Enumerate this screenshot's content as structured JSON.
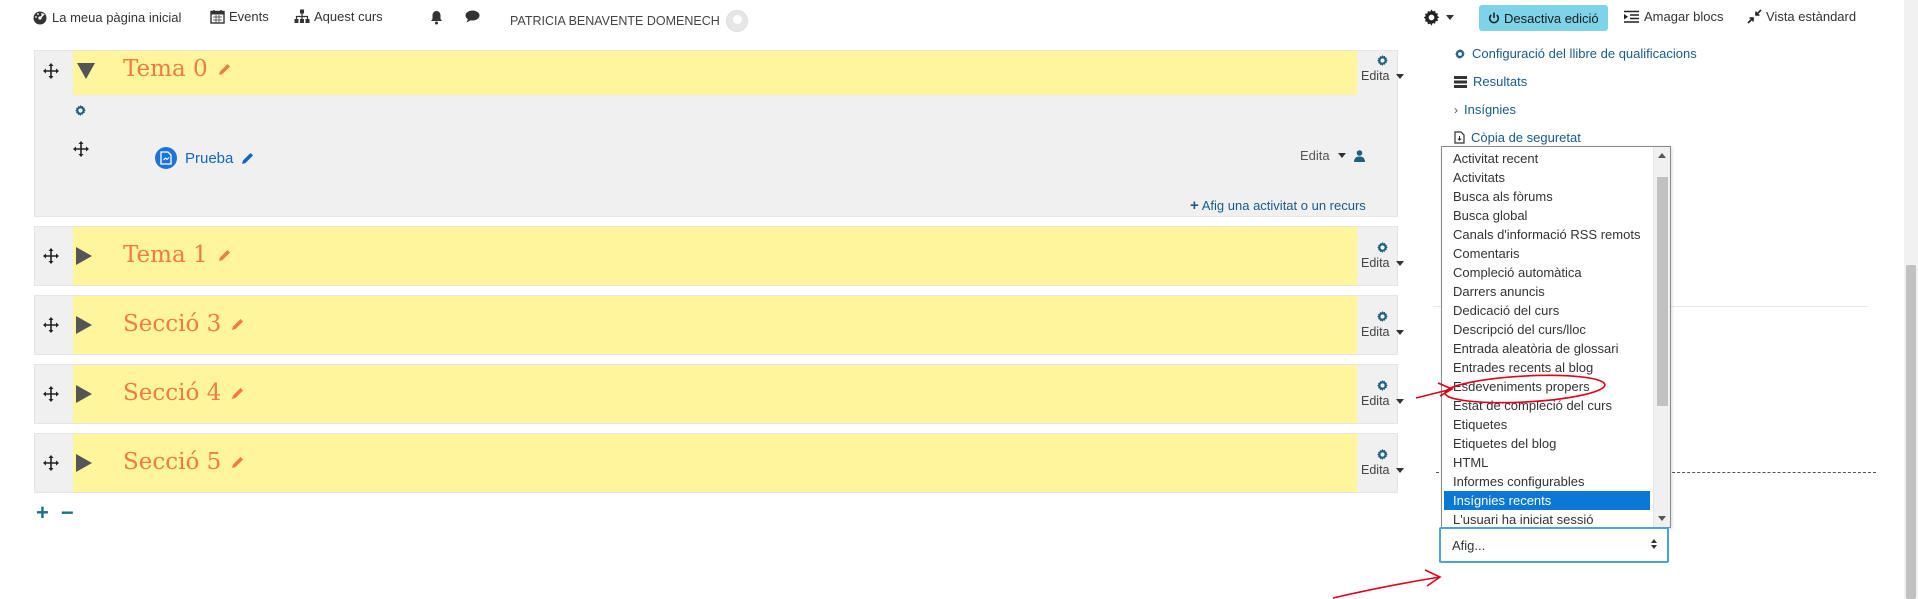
{
  "nav": {
    "home": "La meua pàgina inicial",
    "events": "Events",
    "course": "Aquest curs",
    "user": "PATRICIA BENAVENTE DOMENECH",
    "edit_off": "Desactiva edició",
    "hide_blocks": "Amagar blocs",
    "standard_view": "Vista estàndard"
  },
  "sections": [
    {
      "title": "Tema 0",
      "edit": "Edita"
    },
    {
      "title": "Tema 1",
      "edit": "Edita"
    },
    {
      "title": "Secció 3",
      "edit": "Edita"
    },
    {
      "title": "Secció 4",
      "edit": "Edita"
    },
    {
      "title": "Secció 5",
      "edit": "Edita"
    }
  ],
  "activity": {
    "name": "Prueba",
    "edit": "Edita",
    "add": "Afig una activitat o un recurs"
  },
  "admin_links": {
    "gradebook_setup": "Configuració del llibre de qualificacions",
    "outcomes": "Resultats",
    "badges": "Insígnies",
    "backup": "Còpia de seguretat"
  },
  "block_list": {
    "items": [
      "Activitat recent",
      "Activitats",
      "Busca als fòrums",
      "Busca global",
      "Canals d'informació RSS remots",
      "Comentaris",
      "Compleció automàtica",
      "Darrers anuncis",
      "Dedicació del curs",
      "Descripció del curs/lloc",
      "Entrada aleatòria de glossari",
      "Entrades recents al blog",
      "Esdeveniments propers",
      "Estat de compleció del curs",
      "Etiquetes",
      "Etiquetes del blog",
      "HTML",
      "Informes configurables",
      "Insígnies recents",
      "L'usuari ha iniciat sessió"
    ],
    "selected": "Insígnies recents"
  },
  "add_block_select": {
    "value": "Afig..."
  },
  "colors": {
    "section_bg": "#fff59d",
    "section_title": "#f07a48",
    "link": "#1a5a8a",
    "edit_off_bg": "#7dd3e8",
    "selected_bg": "#0a78d4",
    "annotation": "#e0001b"
  }
}
